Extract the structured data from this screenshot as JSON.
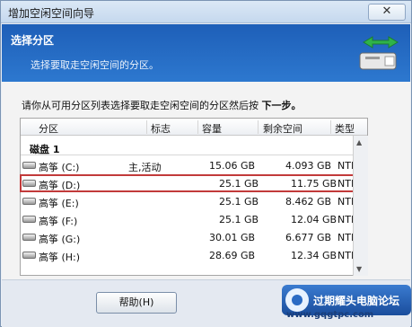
{
  "window": {
    "title": "增加空闲空间向导",
    "close_glyph": "✕"
  },
  "header": {
    "title": "选择分区",
    "subtitle": "选择要取走空闲空间的分区。",
    "icon": "disk-arrows-icon"
  },
  "content": {
    "instruction_prefix": "请你从可用分区列表选择要取走空闲空间的分区然后按 ",
    "instruction_bold": "下一步。"
  },
  "table": {
    "columns": [
      "分区",
      "标志",
      "容量",
      "剩余空间",
      "类型"
    ],
    "disk_label": "磁盘 1",
    "rows": [
      {
        "name": "高筝 (C:)",
        "flag": "主,活动",
        "capacity": "15.06 GB",
        "free": "4.093 GB",
        "type": "NTFS",
        "selected": false
      },
      {
        "name": "高筝 (D:)",
        "flag": "",
        "capacity": "25.1 GB",
        "free": "11.75 GB",
        "type": "NTFS",
        "selected": true
      },
      {
        "name": "高筝 (E:)",
        "flag": "",
        "capacity": "25.1 GB",
        "free": "8.462 GB",
        "type": "NTFS",
        "selected": false
      },
      {
        "name": "高筝 (F:)",
        "flag": "",
        "capacity": "25.1 GB",
        "free": "12.04 GB",
        "type": "NTFS",
        "selected": false
      },
      {
        "name": "高筝 (G:)",
        "flag": "",
        "capacity": "30.01 GB",
        "free": "6.677 GB",
        "type": "NTFS",
        "selected": false
      },
      {
        "name": "高筝 (H:)",
        "flag": "",
        "capacity": "28.69 GB",
        "free": "12.34 GB",
        "type": "NTFS",
        "selected": false
      }
    ]
  },
  "footer": {
    "help_label": "帮助(H)"
  },
  "watermark": {
    "text": "过期耀头电脑论坛",
    "url": "www.gqgtpc.com"
  },
  "colors": {
    "header_blue": "#1e5fb8",
    "selected_outline": "#c23a3a"
  }
}
